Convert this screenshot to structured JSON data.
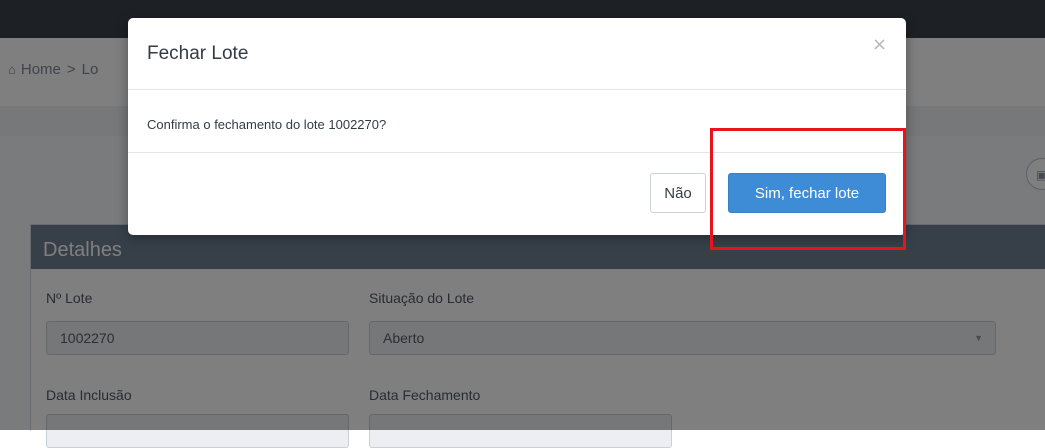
{
  "breadcrumb": {
    "home_icon": "home-icon",
    "home": "Home",
    "separator": ">",
    "current": "Lo"
  },
  "details_panel": {
    "title": "Detalhes",
    "fields": {
      "lote_label": "Nº Lote",
      "lote_value": "1002270",
      "situacao_label": "Situação do Lote",
      "situacao_value": "Aberto",
      "inclusao_label": "Data Inclusão",
      "fechamento_label": "Data Fechamento"
    }
  },
  "modal": {
    "title": "Fechar Lote",
    "close_glyph": "×",
    "message": "Confirma o fechamento do lote 1002270?",
    "cancel_label": "Não",
    "confirm_label": "Sim, fechar lote"
  },
  "colors": {
    "primary": "#3e8cd6",
    "highlight": "#e8141b",
    "panel_header": "#6f8193",
    "topbar": "#3a414b"
  }
}
